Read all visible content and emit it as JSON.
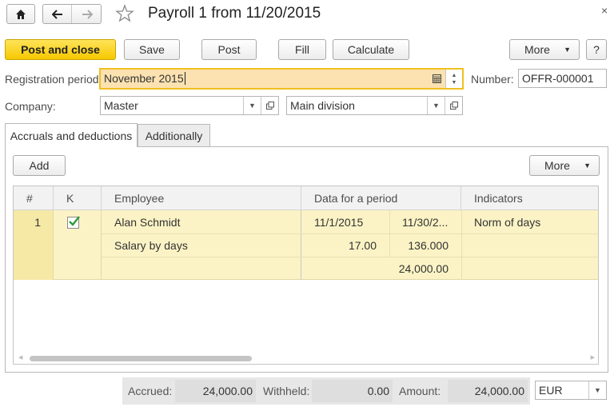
{
  "title": "Payroll 1 from 11/20/2015",
  "toolbar": {
    "post_close": "Post and close",
    "save": "Save",
    "post": "Post",
    "fill": "Fill",
    "calculate": "Calculate",
    "more": "More",
    "help": "?"
  },
  "form": {
    "registration_label": "Registration period:",
    "registration_value": "November 2015",
    "number_label": "Number:",
    "number_value": "OFFR-000001",
    "company_label": "Company:",
    "company_value": "Master",
    "division_value": "Main division"
  },
  "tabs": [
    {
      "label": "Accruals and deductions",
      "active": true
    },
    {
      "label": "Additionally",
      "active": false
    }
  ],
  "table_toolbar": {
    "add": "Add",
    "more": "More"
  },
  "table": {
    "headers": [
      "#",
      "K",
      "Employee",
      "Data for a period",
      "Indicators"
    ],
    "row": {
      "num": "1",
      "checked": true,
      "employee": "Alan Schmidt",
      "date_from": "11/1/2015",
      "date_to": "11/30/2...",
      "indicator": "Norm of days",
      "accrual": "Salary by days",
      "val1": "17.00",
      "val2": "136.000",
      "amount": "24,000.00"
    }
  },
  "footer": {
    "accrued_label": "Accrued:",
    "accrued_value": "24,000.00",
    "withheld_label": "Withheld:",
    "withheld_value": "0.00",
    "amount_label": "Amount:",
    "amount_value": "24,000.00",
    "currency": "EUR"
  },
  "colors": {
    "accent_yellow": "#f6c800",
    "row_highlight": "#fbf3c5",
    "field_active": "#fbe2b0"
  }
}
